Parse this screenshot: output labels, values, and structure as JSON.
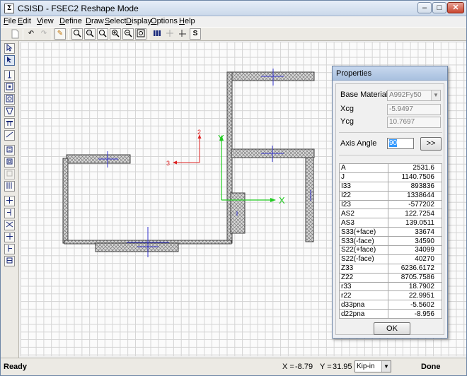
{
  "window": {
    "title": "CSISD - FSEC2  Reshape Mode",
    "app_icon": "Σ",
    "controls": {
      "minimize": "–",
      "maximize": "□",
      "close": "✕"
    }
  },
  "menu": [
    {
      "accel": "F",
      "rest": "ile"
    },
    {
      "accel": "E",
      "rest": "dit"
    },
    {
      "accel": "V",
      "rest": "iew"
    },
    {
      "accel": "D",
      "rest": "efine"
    },
    {
      "accel": "D",
      "rest": "raw"
    },
    {
      "accel": "S",
      "rest": "elect"
    },
    {
      "accel": "D",
      "rest": "isplay"
    },
    {
      "accel": "O",
      "rest": "ptions"
    },
    {
      "accel": "H",
      "rest": "elp"
    }
  ],
  "toolbar": {
    "icons": [
      "new-icon",
      "undo-icon",
      "redo-icon",
      "pencil-icon",
      "zoom-window-icon",
      "zoom-restore-icon",
      "zoom-previous-icon",
      "zoom-in-icon",
      "zoom-out-icon",
      "zoom-fit-icon",
      "section-designer-icon",
      "rebar-icon",
      "axis-icon",
      "stress-icon"
    ],
    "glyphs": {
      "undo": "↶",
      "redo": "↷",
      "pencil": "✎",
      "stress": "S"
    }
  },
  "left_tools": {
    "icons": [
      "pointer-icon",
      "reshape-pointer-icon",
      "draw-line-icon",
      "draw-point-icon",
      "draw-circle-icon",
      "draw-polygon-icon",
      "draw-tee-icon",
      "draw-angle-icon",
      "draw-channel-icon",
      "draw-plate-icon",
      "draw-rebar-icon",
      "draw-bar-line-icon",
      "snap-intersection-icon",
      "snap-end-icon",
      "snap-middle-icon",
      "snap-perpendicular-icon",
      "snap-line-icon",
      "snap-grid-icon"
    ]
  },
  "canvas": {
    "axes": {
      "global_x": "X",
      "global_y": "Y",
      "local_2": "2",
      "local_3": "3"
    },
    "colors": {
      "global_axis": "#22cc22",
      "local_axis": "#dd2222",
      "centroid": "#3333cc",
      "section_edge": "#404040",
      "hatch": "#8a8a8a"
    }
  },
  "properties": {
    "title": "Properties",
    "base_material_label": "Base Material",
    "base_material_value": "A992Fy50",
    "xcg_label": "Xcg",
    "xcg_value": "-5.9497",
    "ycg_label": "Ycg",
    "ycg_value": "10.7697",
    "axis_angle_label": "Axis Angle",
    "axis_angle_value": "90",
    "expand_button": ">>",
    "rows": [
      {
        "name": "A",
        "value": "2531.6"
      },
      {
        "name": "J",
        "value": "1140.7506"
      },
      {
        "name": "I33",
        "value": "893836"
      },
      {
        "name": "I22",
        "value": "1338644"
      },
      {
        "name": "I23",
        "value": "-577202"
      },
      {
        "name": "AS2",
        "value": "122.7254"
      },
      {
        "name": "AS3",
        "value": "139.0511"
      },
      {
        "name": "S33(+face)",
        "value": "33674"
      },
      {
        "name": "S33(-face)",
        "value": "34590"
      },
      {
        "name": "S22(+face)",
        "value": "34099"
      },
      {
        "name": "S22(-face)",
        "value": "40270"
      },
      {
        "name": "Z33",
        "value": "6236.6172"
      },
      {
        "name": "Z22",
        "value": "8705.7586"
      },
      {
        "name": "r33",
        "value": "18.7902"
      },
      {
        "name": "r22",
        "value": "22.9951"
      },
      {
        "name": "d33pna",
        "value": "-5.5602"
      },
      {
        "name": "d22pna",
        "value": "-8.956"
      }
    ],
    "ok_label": "OK"
  },
  "status": {
    "left": "Ready",
    "x_label": "X =",
    "x_value": "-8.79",
    "y_label": "Y =",
    "y_value": "31.95",
    "units": "Kip-in",
    "right": "Done"
  }
}
